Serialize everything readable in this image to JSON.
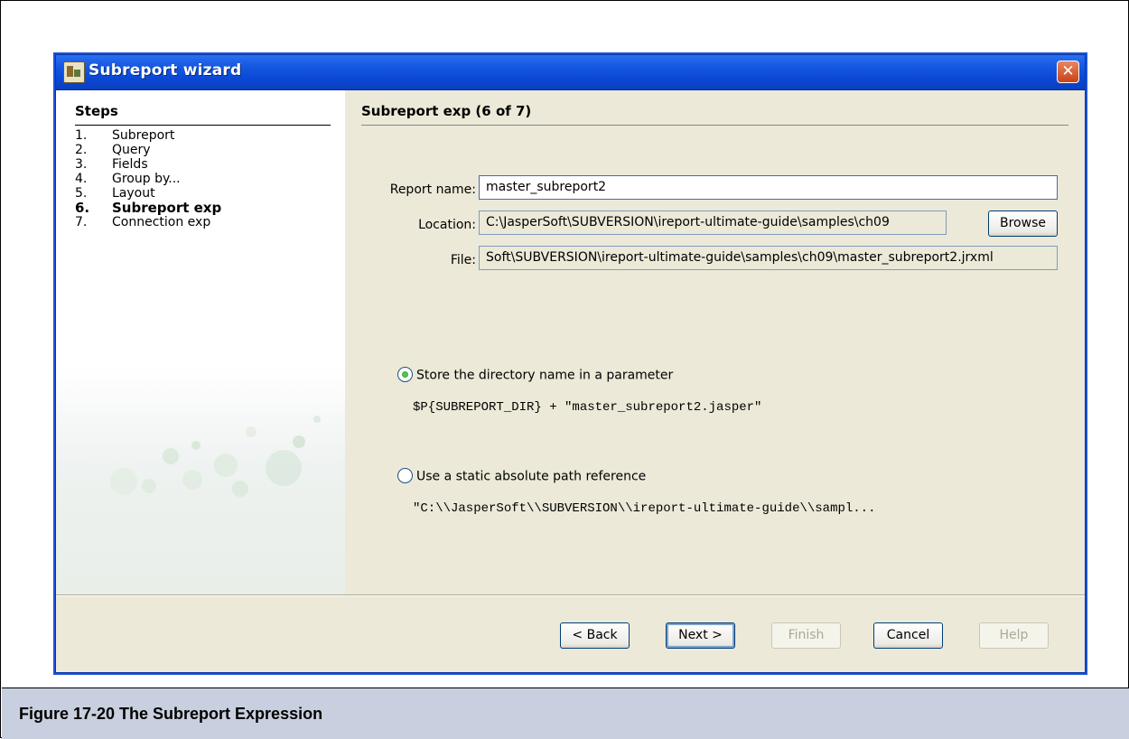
{
  "window": {
    "title": "Subreport wizard",
    "close_glyph": "✕"
  },
  "steps": {
    "title": "Steps",
    "items": [
      {
        "num": "1.",
        "label": "Subreport"
      },
      {
        "num": "2.",
        "label": "Query"
      },
      {
        "num": "3.",
        "label": "Fields"
      },
      {
        "num": "4.",
        "label": "Group by..."
      },
      {
        "num": "5.",
        "label": "Layout"
      },
      {
        "num": "6.",
        "label": "Subreport exp"
      },
      {
        "num": "7.",
        "label": "Connection exp"
      }
    ],
    "current_index": 5
  },
  "content": {
    "title": "Subreport exp (6 of 7)",
    "report_name": {
      "label": "Report name:",
      "value": "master_subreport2"
    },
    "location": {
      "label": "Location:",
      "value": "C:\\JasperSoft\\SUBVERSION\\ireport-ultimate-guide\\samples\\ch09",
      "browse_label": "Browse"
    },
    "file": {
      "label": "File:",
      "value": "Soft\\SUBVERSION\\ireport-ultimate-guide\\samples\\ch09\\master_subreport2.jrxml"
    },
    "options": [
      {
        "label": "Store the directory name in a parameter",
        "selected": true,
        "expression": "$P{SUBREPORT_DIR} + \"master_subreport2.jasper\""
      },
      {
        "label": "Use a static absolute path reference",
        "selected": false,
        "expression": "\"C:\\\\JasperSoft\\\\SUBVERSION\\\\ireport-ultimate-guide\\\\sampl..."
      }
    ]
  },
  "buttons": {
    "back": {
      "label": "< Back",
      "enabled": true
    },
    "next": {
      "label": "Next >",
      "enabled": true
    },
    "finish": {
      "label": "Finish",
      "enabled": false
    },
    "cancel": {
      "label": "Cancel",
      "enabled": true
    },
    "help": {
      "label": "Help",
      "enabled": false
    }
  },
  "caption": "Figure 17-20  The Subreport Expression",
  "colors": {
    "titlebar": "#0a48d4",
    "dialog_bg": "#ece9d8",
    "close_button": "#c84218",
    "caption_bar": "#c8cfde",
    "radio_selected": "#21a121"
  }
}
